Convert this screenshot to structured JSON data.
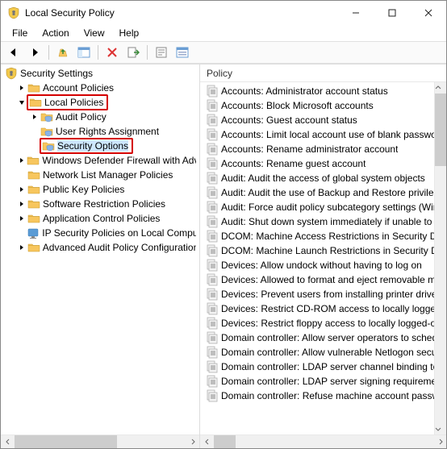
{
  "window": {
    "title": "Local Security Policy"
  },
  "menu": {
    "file": "File",
    "action": "Action",
    "view": "View",
    "help": "Help"
  },
  "tree": {
    "root": "Security Settings",
    "items": [
      {
        "label": "Account Policies",
        "depth": 1,
        "exp": "closed"
      },
      {
        "label": "Local Policies",
        "depth": 1,
        "exp": "open",
        "redbox": true
      },
      {
        "label": "Audit Policy",
        "depth": 2,
        "exp": "closed"
      },
      {
        "label": "User Rights Assignment",
        "depth": 2,
        "exp": "none"
      },
      {
        "label": "Security Options",
        "depth": 2,
        "exp": "none",
        "redbox": true,
        "selected": true
      },
      {
        "label": "Windows Defender Firewall with Adva",
        "depth": 1,
        "exp": "closed"
      },
      {
        "label": "Network List Manager Policies",
        "depth": 1,
        "exp": "none"
      },
      {
        "label": "Public Key Policies",
        "depth": 1,
        "exp": "closed"
      },
      {
        "label": "Software Restriction Policies",
        "depth": 1,
        "exp": "closed"
      },
      {
        "label": "Application Control Policies",
        "depth": 1,
        "exp": "closed"
      },
      {
        "label": "IP Security Policies on Local Compute",
        "depth": 1,
        "exp": "none",
        "icon": "ip"
      },
      {
        "label": "Advanced Audit Policy Configuration",
        "depth": 1,
        "exp": "closed"
      }
    ]
  },
  "list": {
    "header": "Policy",
    "rows": [
      "Accounts: Administrator account status",
      "Accounts: Block Microsoft accounts",
      "Accounts: Guest account status",
      "Accounts: Limit local account use of blank passwo",
      "Accounts: Rename administrator account",
      "Accounts: Rename guest account",
      "Audit: Audit the access of global system objects",
      "Audit: Audit the use of Backup and Restore privileg",
      "Audit: Force audit policy subcategory settings (Win",
      "Audit: Shut down system immediately if unable to",
      "DCOM: Machine Access Restrictions in Security De",
      "DCOM: Machine Launch Restrictions in Security De",
      "Devices: Allow undock without having to log on",
      "Devices: Allowed to format and eject removable m",
      "Devices: Prevent users from installing printer driver",
      "Devices: Restrict CD-ROM access to locally logged-",
      "Devices: Restrict floppy access to locally logged-or",
      "Domain controller: Allow server operators to sched",
      "Domain controller: Allow vulnerable Netlogon secu",
      "Domain controller: LDAP server channel binding to",
      "Domain controller: LDAP server signing requiremen",
      "Domain controller: Refuse machine account passw"
    ]
  }
}
